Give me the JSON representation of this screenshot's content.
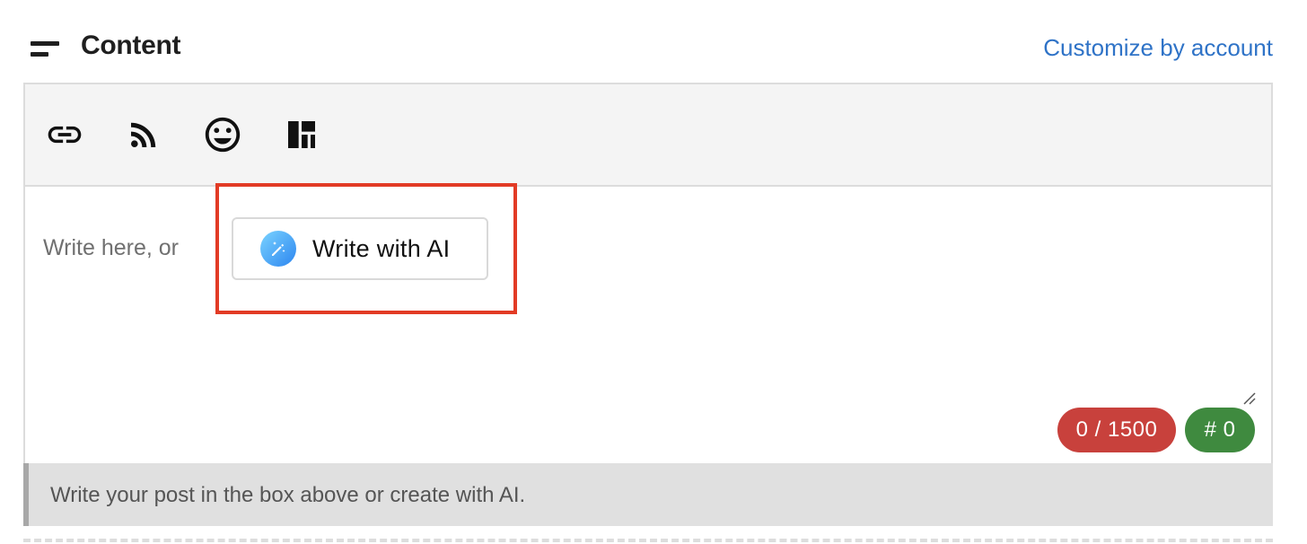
{
  "header": {
    "title": "Content",
    "icon": "drag-handle-icon",
    "customize_link": "Customize by account"
  },
  "toolbar": {
    "tools": [
      {
        "name": "link-icon"
      },
      {
        "name": "rss-feed-icon"
      },
      {
        "name": "emoji-icon"
      },
      {
        "name": "layout-grid-icon"
      }
    ]
  },
  "editor": {
    "placeholder": "Write here, or",
    "ai_button_label": "Write with AI",
    "ai_icon": "magic-pen-icon",
    "char_count": "0 / 1500",
    "hashtag_count": "# 0"
  },
  "hint": {
    "text": "Write your post in the box above or create with AI."
  },
  "colors": {
    "link": "#2f73c7",
    "highlight": "#e23b25",
    "char_badge": "#c8413c",
    "hash_badge": "#3f8a3f"
  }
}
